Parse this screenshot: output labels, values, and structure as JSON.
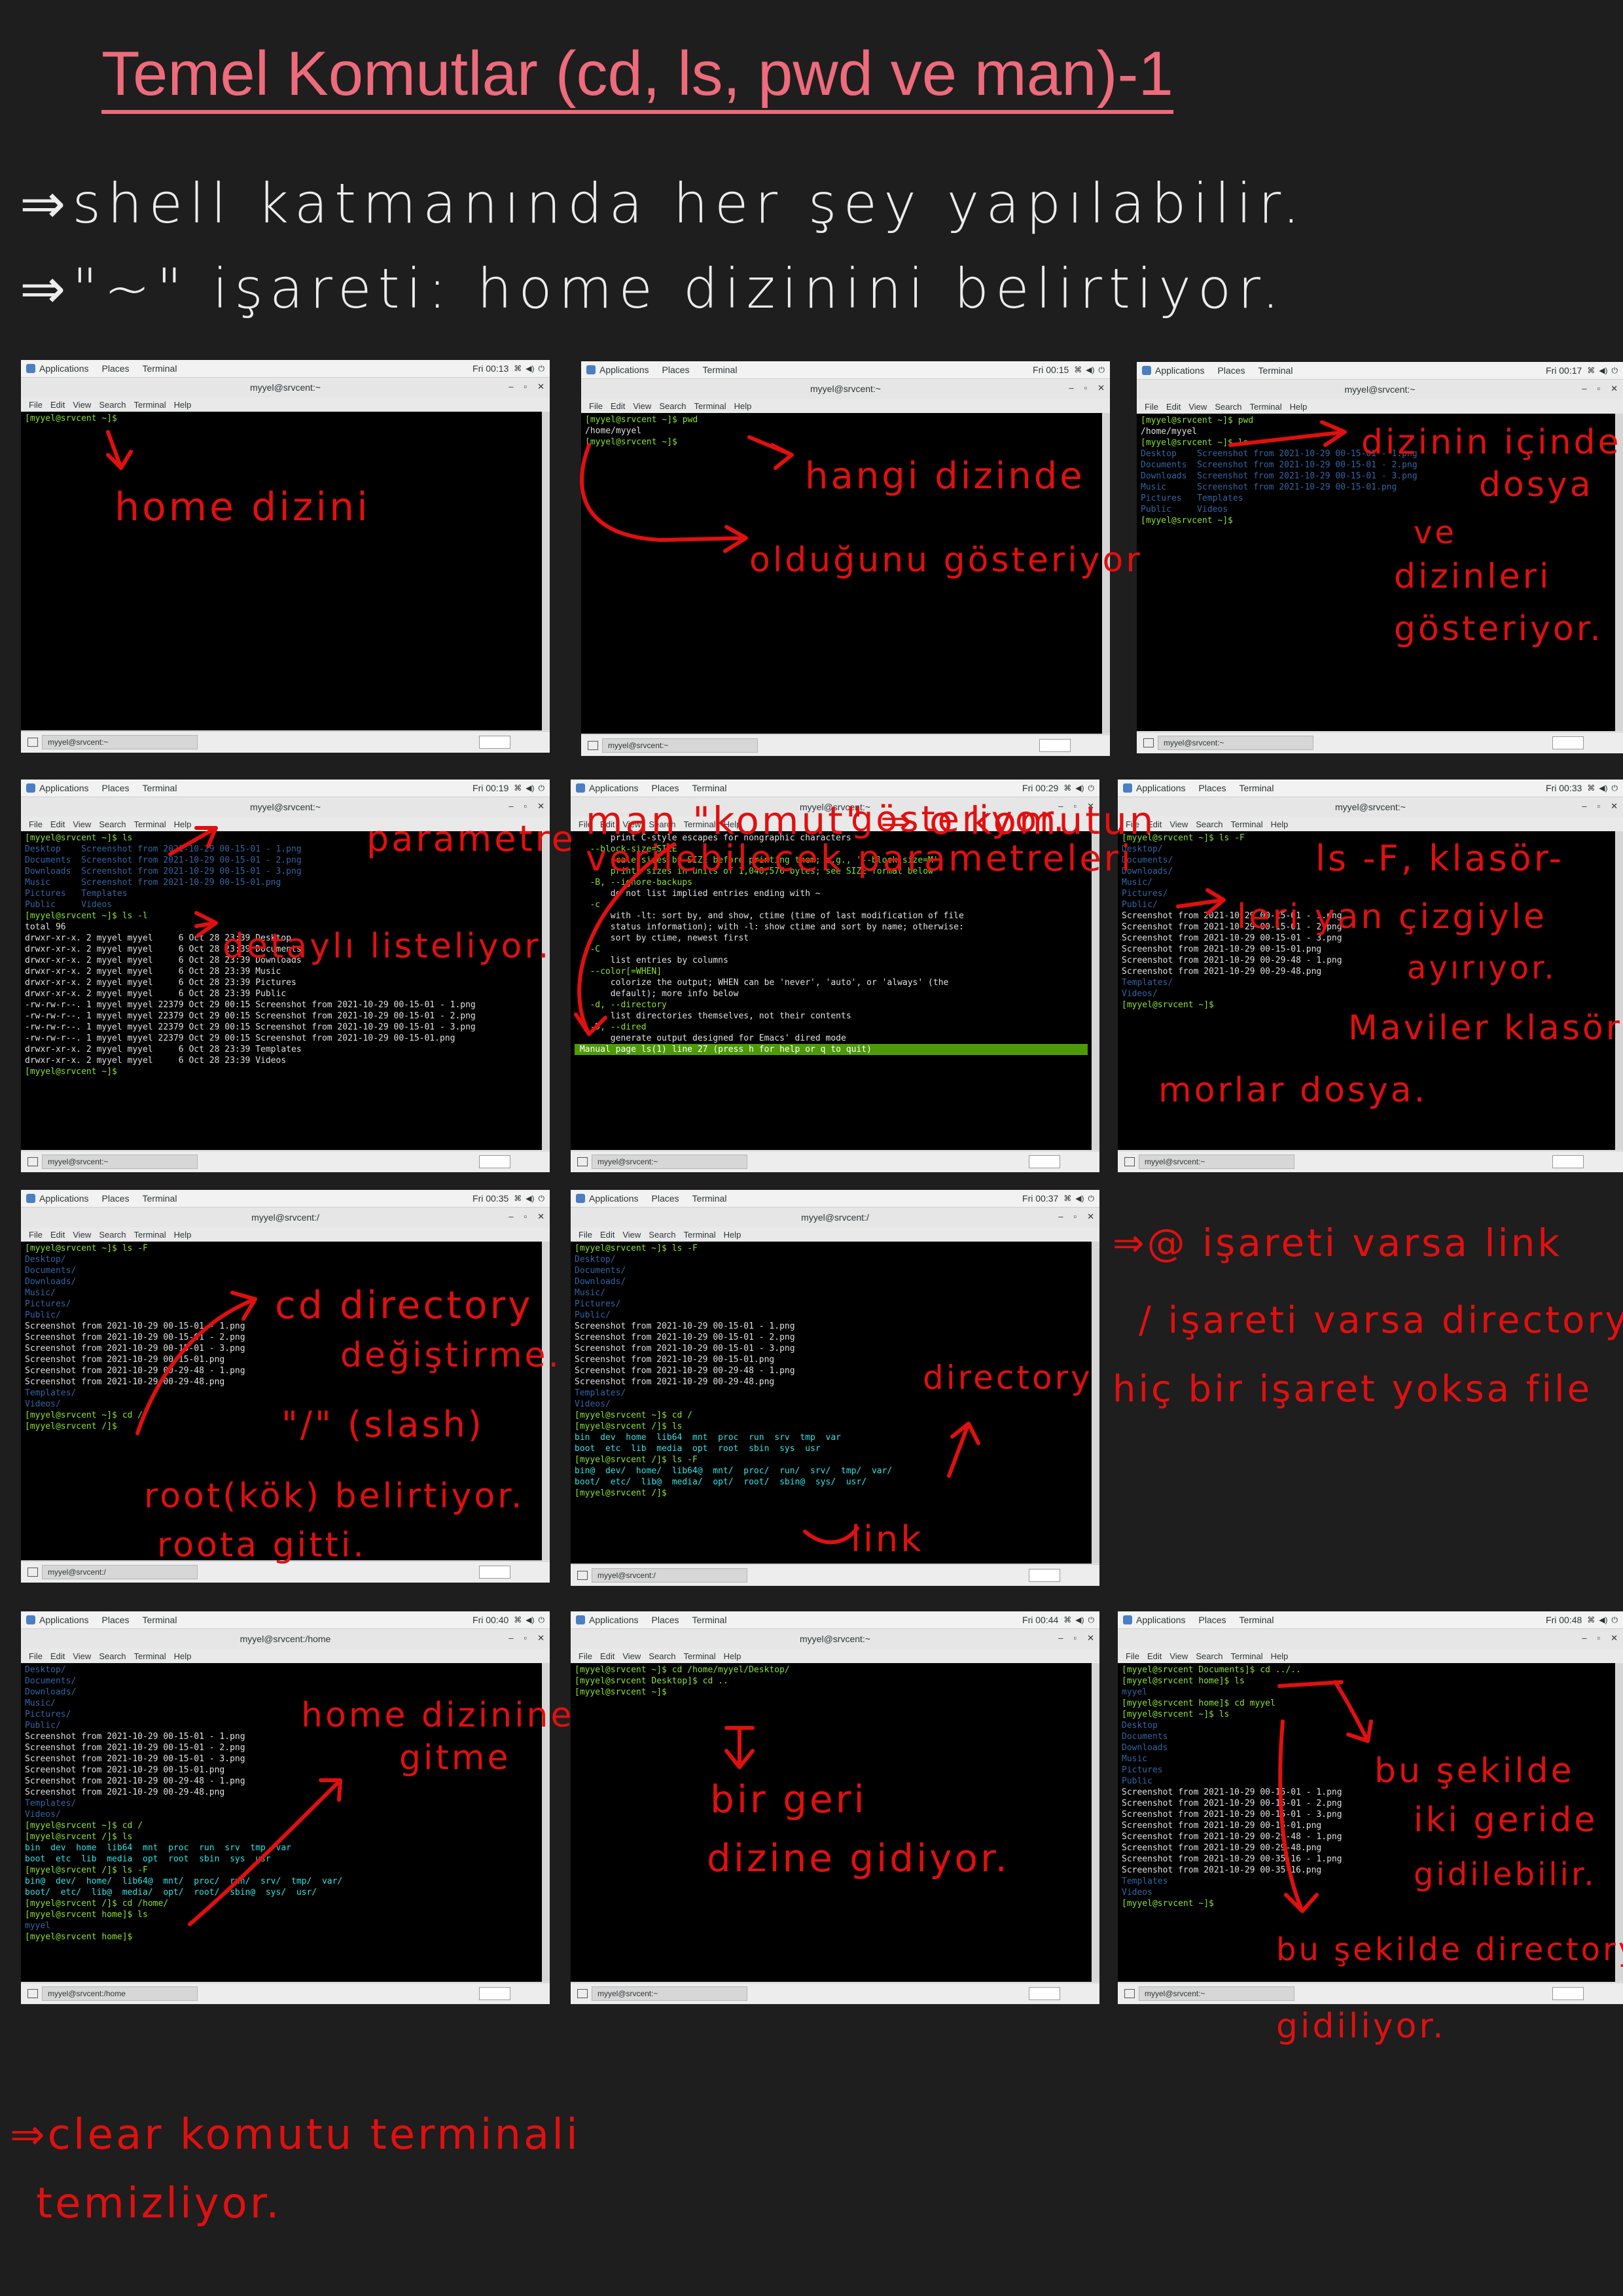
{
  "title": "Temel Komutlar (cd, ls, pwd ve man)-1",
  "notes": [
    "⇒shell katmanında her şey yapılabilir.",
    "⇒\"~\" işareti: home dizinini belirtiyor.",
    "⇒clear komutu terminali",
    "temizliyor."
  ],
  "right_notes": [
    "⇒@ işareti varsa link",
    "/ işareti varsa directory",
    "hiç bir işaret yoksa file"
  ],
  "colors": {
    "accent": "#ee6b7b",
    "ink": "#e01010",
    "prompt": "#8ae234",
    "dir": "#3465a4"
  },
  "panel": {
    "apps": "Applications",
    "places": "Places",
    "terminal": "Terminal",
    "menus": [
      "File",
      "Edit",
      "View",
      "Search",
      "Terminal",
      "Help"
    ],
    "window_title": "myyel@srvcent:~"
  },
  "screens": [
    {
      "clock": "Fri 00:13",
      "title": "myyel@srvcent:~",
      "task": "myyel@srvcent:~",
      "lines": [
        [
          "g",
          "[myyel@srvcent ~]$ "
        ]
      ],
      "annotations": [
        "home dizini"
      ]
    },
    {
      "clock": "Fri 00:15",
      "title": "myyel@srvcent:~",
      "task": "myyel@srvcent:~",
      "lines": [
        [
          "g",
          "[myyel@srvcent ~]$ pwd"
        ],
        [
          "",
          "/home/myyel"
        ],
        [
          "g",
          "[myyel@srvcent ~]$ "
        ]
      ],
      "annotations": [
        "hangi dizinde",
        "olduğunu gösteriyor"
      ]
    },
    {
      "clock": "Fri 00:17",
      "title": "myyel@srvcent:~",
      "task": "myyel@srvcent:~",
      "lines": [
        [
          "g",
          "[myyel@srvcent ~]$ pwd"
        ],
        [
          "",
          "/home/myyel"
        ],
        [
          "g",
          "[myyel@srvcent ~]$ ls"
        ],
        [
          "b",
          "Desktop    Screenshot from 2021-10-29 00-15-01 - 1.png"
        ],
        [
          "b",
          "Documents  Screenshot from 2021-10-29 00-15-01 - 2.png"
        ],
        [
          "b",
          "Downloads  Screenshot from 2021-10-29 00-15-01 - 3.png"
        ],
        [
          "b",
          "Music      Screenshot from 2021-10-29 00-15-01.png"
        ],
        [
          "b",
          "Pictures   Templates"
        ],
        [
          "b",
          "Public     Videos"
        ],
        [
          "g",
          "[myyel@srvcent ~]$ "
        ]
      ],
      "annotations": [
        "dizinin içindeki",
        "dosya",
        "ve",
        "dizinleri",
        "gösteriyor."
      ]
    },
    {
      "clock": "Fri 00:19",
      "title": "myyel@srvcent:~",
      "task": "myyel@srvcent:~",
      "lines": [
        [
          "g",
          "[myyel@srvcent ~]$ ls"
        ],
        [
          "b",
          "Desktop    Screenshot from 2021-10-29 00-15-01 - 1.png"
        ],
        [
          "b",
          "Documents  Screenshot from 2021-10-29 00-15-01 - 2.png"
        ],
        [
          "b",
          "Downloads  Screenshot from 2021-10-29 00-15-01 - 3.png"
        ],
        [
          "b",
          "Music      Screenshot from 2021-10-29 00-15-01.png"
        ],
        [
          "b",
          "Pictures   Templates"
        ],
        [
          "b",
          "Public     Videos"
        ],
        [
          "g",
          "[myyel@srvcent ~]$ ls -l"
        ],
        [
          "",
          "total 96"
        ],
        [
          "",
          "drwxr-xr-x. 2 myyel myyel     6 Oct 28 23:39 Desktop"
        ],
        [
          "",
          "drwxr-xr-x. 2 myyel myyel     6 Oct 28 23:39 Documents"
        ],
        [
          "",
          "drwxr-xr-x. 2 myyel myyel     6 Oct 28 23:39 Downloads"
        ],
        [
          "",
          "drwxr-xr-x. 2 myyel myyel     6 Oct 28 23:39 Music"
        ],
        [
          "",
          "drwxr-xr-x. 2 myyel myyel     6 Oct 28 23:39 Pictures"
        ],
        [
          "",
          "drwxr-xr-x. 2 myyel myyel     6 Oct 28 23:39 Public"
        ],
        [
          "",
          "-rw-rw-r--. 1 myyel myyel 22379 Oct 29 00:15 Screenshot from 2021-10-29 00-15-01 - 1.png"
        ],
        [
          "",
          "-rw-rw-r--. 1 myyel myyel 22379 Oct 29 00:15 Screenshot from 2021-10-29 00-15-01 - 2.png"
        ],
        [
          "",
          "-rw-rw-r--. 1 myyel myyel 22379 Oct 29 00:15 Screenshot from 2021-10-29 00-15-01 - 3.png"
        ],
        [
          "",
          "-rw-rw-r--. 1 myyel myyel 22379 Oct 29 00:15 Screenshot from 2021-10-29 00-15-01.png"
        ],
        [
          "",
          "drwxr-xr-x. 2 myyel myyel     6 Oct 28 23:39 Templates"
        ],
        [
          "",
          "drwxr-xr-x. 2 myyel myyel     6 Oct 28 23:39 Videos"
        ],
        [
          "g",
          "[myyel@srvcent ~]$ "
        ]
      ],
      "annotations": [
        "parametre",
        "detaylı listeliyor."
      ]
    },
    {
      "clock": "Fri 00:29",
      "title": "myyel@srvcent:~",
      "task": "myyel@srvcent:~",
      "lines": [
        [
          "",
          ""
        ],
        [
          "",
          "       print C-style escapes for nongraphic characters"
        ],
        [
          "",
          ""
        ],
        [
          "g",
          "   --block-size=SIZE"
        ],
        [
          "g",
          "       scale sizes by SIZE before printing them; e.g., '--block-size=M'"
        ],
        [
          "g",
          "       prints sizes in units of 1,048,576 bytes; see SIZE format below"
        ],
        [
          "",
          ""
        ],
        [
          "g",
          "   -B, --ignore-backups"
        ],
        [
          "",
          "       do not list implied entries ending with ~"
        ],
        [
          "",
          ""
        ],
        [
          "g",
          "   -c"
        ],
        [
          "",
          "       with -lt: sort by, and show, ctime (time of last modification of file"
        ],
        [
          "",
          "       status information); with -l: show ctime and sort by name; otherwise:"
        ],
        [
          "",
          "       sort by ctime, newest first"
        ],
        [
          "",
          ""
        ],
        [
          "g",
          "   -C"
        ],
        [
          "",
          "       list entries by columns"
        ],
        [
          "",
          ""
        ],
        [
          "g",
          "   --color[=WHEN]"
        ],
        [
          "",
          "       colorize the output; WHEN can be 'never', 'auto', or 'always' (the"
        ],
        [
          "",
          "       default); more info below"
        ],
        [
          "",
          ""
        ],
        [
          "g",
          "   -d, --directory"
        ],
        [
          "",
          "       list directories themselves, not their contents"
        ],
        [
          "",
          ""
        ],
        [
          "g",
          "   -D, --dired"
        ],
        [
          "",
          "       generate output designed for Emacs' dired mode"
        ],
        [
          "bar",
          " Manual page ls(1) line 27 (press h for help or q to quit)"
        ]
      ],
      "annotations": [
        "man \"komut\" ⇒ o komutun",
        "verilebilecek parametreleri",
        "gösteriyor."
      ]
    },
    {
      "clock": "Fri 00:33",
      "title": "myyel@srvcent:~",
      "task": "myyel@srvcent:~",
      "lines": [
        [
          "g",
          "[myyel@srvcent ~]$ ls -F"
        ],
        [
          "b",
          "Desktop/"
        ],
        [
          "b",
          "Documents/"
        ],
        [
          "b",
          "Downloads/"
        ],
        [
          "b",
          "Music/"
        ],
        [
          "b",
          "Pictures/"
        ],
        [
          "b",
          "Public/"
        ],
        [
          "",
          "Screenshot from 2021-10-29 00-15-01 - 1.png"
        ],
        [
          "",
          "Screenshot from 2021-10-29 00-15-01 - 2.png"
        ],
        [
          "",
          "Screenshot from 2021-10-29 00-15-01 - 3.png"
        ],
        [
          "",
          "Screenshot from 2021-10-29 00-15-01.png"
        ],
        [
          "",
          "Screenshot from 2021-10-29 00-29-48 - 1.png"
        ],
        [
          "",
          "Screenshot from 2021-10-29 00-29-48.png"
        ],
        [
          "b",
          "Templates/"
        ],
        [
          "b",
          "Videos/"
        ],
        [
          "g",
          "[myyel@srvcent ~]$ "
        ]
      ],
      "annotations": [
        "ls -F, klasör-",
        "leri yan çizgiyle",
        "ayırıyor.",
        "Maviler klasör,",
        "morlar dosya."
      ]
    },
    {
      "clock": "Fri 00:35",
      "title": "myyel@srvcent:/",
      "task": "myyel@srvcent:/",
      "lines": [
        [
          "g",
          "[myyel@srvcent ~]$ ls -F"
        ],
        [
          "b",
          "Desktop/"
        ],
        [
          "b",
          "Documents/"
        ],
        [
          "b",
          "Downloads/"
        ],
        [
          "b",
          "Music/"
        ],
        [
          "b",
          "Pictures/"
        ],
        [
          "b",
          "Public/"
        ],
        [
          "",
          "Screenshot from 2021-10-29 00-15-01 - 1.png"
        ],
        [
          "",
          "Screenshot from 2021-10-29 00-15-01 - 2.png"
        ],
        [
          "",
          "Screenshot from 2021-10-29 00-15-01 - 3.png"
        ],
        [
          "",
          "Screenshot from 2021-10-29 00-15-01.png"
        ],
        [
          "",
          "Screenshot from 2021-10-29 00-29-48 - 1.png"
        ],
        [
          "",
          "Screenshot from 2021-10-29 00-29-48.png"
        ],
        [
          "b",
          "Templates/"
        ],
        [
          "b",
          "Videos/"
        ],
        [
          "g",
          "[myyel@srvcent ~]$ cd /"
        ],
        [
          "g",
          "[myyel@srvcent /]$ "
        ]
      ],
      "annotations": [
        "cd directory",
        "değiştirme.",
        "\"/\" (slash)",
        "root(kök) belirtiyor.",
        "roota gitti."
      ]
    },
    {
      "clock": "Fri 00:37",
      "title": "myyel@srvcent:/",
      "task": "myyel@srvcent:/",
      "lines": [
        [
          "g",
          "[myyel@srvcent ~]$ ls -F"
        ],
        [
          "b",
          "Desktop/"
        ],
        [
          "b",
          "Documents/"
        ],
        [
          "b",
          "Downloads/"
        ],
        [
          "b",
          "Music/"
        ],
        [
          "b",
          "Pictures/"
        ],
        [
          "b",
          "Public/"
        ],
        [
          "",
          "Screenshot from 2021-10-29 00-15-01 - 1.png"
        ],
        [
          "",
          "Screenshot from 2021-10-29 00-15-01 - 2.png"
        ],
        [
          "",
          "Screenshot from 2021-10-29 00-15-01 - 3.png"
        ],
        [
          "",
          "Screenshot from 2021-10-29 00-15-01.png"
        ],
        [
          "",
          "Screenshot from 2021-10-29 00-29-48 - 1.png"
        ],
        [
          "",
          "Screenshot from 2021-10-29 00-29-48.png"
        ],
        [
          "b",
          "Templates/"
        ],
        [
          "b",
          "Videos/"
        ],
        [
          "g",
          "[myyel@srvcent ~]$ cd /"
        ],
        [
          "g",
          "[myyel@srvcent /]$ ls"
        ],
        [
          "cyan",
          "bin  dev  home  lib64  mnt  proc  run  srv  tmp  var"
        ],
        [
          "cyan",
          "boot  etc  lib  media  opt  root  sbin  sys  usr"
        ],
        [
          "g",
          "[myyel@srvcent /]$ ls -F"
        ],
        [
          "cyan",
          "bin@  dev/  home/  lib64@  mnt/  proc/  run/  srv/  tmp/  var/"
        ],
        [
          "cyan",
          "boot/  etc/  lib@  media/  opt/  root/  sbin@  sys/  usr/"
        ],
        [
          "g",
          "[myyel@srvcent /]$ "
        ]
      ],
      "annotations": [
        "directory",
        "link"
      ]
    },
    {
      "clock": "Fri 00:40",
      "title": "myyel@srvcent:/home",
      "task": "myyel@srvcent:/home",
      "lines": [
        [
          "b",
          "Desktop/"
        ],
        [
          "b",
          "Documents/"
        ],
        [
          "b",
          "Downloads/"
        ],
        [
          "b",
          "Music/"
        ],
        [
          "b",
          "Pictures/"
        ],
        [
          "b",
          "Public/"
        ],
        [
          "",
          "Screenshot from 2021-10-29 00-15-01 - 1.png"
        ],
        [
          "",
          "Screenshot from 2021-10-29 00-15-01 - 2.png"
        ],
        [
          "",
          "Screenshot from 2021-10-29 00-15-01 - 3.png"
        ],
        [
          "",
          "Screenshot from 2021-10-29 00-15-01.png"
        ],
        [
          "",
          "Screenshot from 2021-10-29 00-29-48 - 1.png"
        ],
        [
          "",
          "Screenshot from 2021-10-29 00-29-48.png"
        ],
        [
          "b",
          "Templates/"
        ],
        [
          "b",
          "Videos/"
        ],
        [
          "g",
          "[myyel@srvcent ~]$ cd /"
        ],
        [
          "g",
          "[myyel@srvcent /]$ ls"
        ],
        [
          "cyan",
          "bin  dev  home  lib64  mnt  proc  run  srv  tmp  var"
        ],
        [
          "cyan",
          "boot  etc  lib  media  opt  root  sbin  sys  usr"
        ],
        [
          "g",
          "[myyel@srvcent /]$ ls -F"
        ],
        [
          "cyan",
          "bin@  dev/  home/  lib64@  mnt/  proc/  run/  srv/  tmp/  var/"
        ],
        [
          "cyan",
          "boot/  etc/  lib@  media/  opt/  root/  sbin@  sys/  usr/"
        ],
        [
          "g",
          "[myyel@srvcent /]$ cd /home/"
        ],
        [
          "g",
          "[myyel@srvcent home]$ ls"
        ],
        [
          "b",
          "myyel"
        ],
        [
          "g",
          "[myyel@srvcent home]$ "
        ]
      ],
      "annotations": [
        "home dizinine",
        "gitme"
      ]
    },
    {
      "clock": "Fri 00:44",
      "title": "myyel@srvcent:~",
      "task": "myyel@srvcent:~",
      "lines": [
        [
          "g",
          "[myyel@srvcent ~]$ cd /home/myyel/Desktop/"
        ],
        [
          "g",
          "[myyel@srvcent Desktop]$ cd .."
        ],
        [
          "g",
          "[myyel@srvcent ~]$ "
        ]
      ],
      "annotations": [
        "bir geri",
        "dizine gidiyor."
      ]
    },
    {
      "clock": "Fri 00:48",
      "title": "",
      "task": "myyel@srvcent:~",
      "lines": [
        [
          "g",
          "[myyel@srvcent Documents]$ cd ../.."
        ],
        [
          "g",
          "[myyel@srvcent home]$ ls"
        ],
        [
          "b",
          "myyel"
        ],
        [
          "g",
          "[myyel@srvcent home]$ cd myyel"
        ],
        [
          "g",
          "[myyel@srvcent ~]$ ls"
        ],
        [
          "b",
          "Desktop"
        ],
        [
          "b",
          "Documents"
        ],
        [
          "b",
          "Downloads"
        ],
        [
          "b",
          "Music"
        ],
        [
          "b",
          "Pictures"
        ],
        [
          "b",
          "Public"
        ],
        [
          "",
          "Screenshot from 2021-10-29 00-15-01 - 1.png"
        ],
        [
          "",
          "Screenshot from 2021-10-29 00-15-01 - 2.png"
        ],
        [
          "",
          "Screenshot from 2021-10-29 00-15-01 - 3.png"
        ],
        [
          "",
          "Screenshot from 2021-10-29 00-15-01.png"
        ],
        [
          "",
          "Screenshot from 2021-10-29 00-29-48 - 1.png"
        ],
        [
          "",
          "Screenshot from 2021-10-29 00-29-48.png"
        ],
        [
          "",
          "Screenshot from 2021-10-29 00-35-16 - 1.png"
        ],
        [
          "",
          "Screenshot from 2021-10-29 00-35-16.png"
        ],
        [
          "b",
          "Templates"
        ],
        [
          "b",
          "Videos"
        ],
        [
          "g",
          "[myyel@srvcent ~]$ "
        ]
      ],
      "annotations": [
        "bu şekilde",
        "iki geride",
        "gidilebilir.",
        "bu şekilde directory'e",
        "gidiliyor."
      ]
    }
  ]
}
